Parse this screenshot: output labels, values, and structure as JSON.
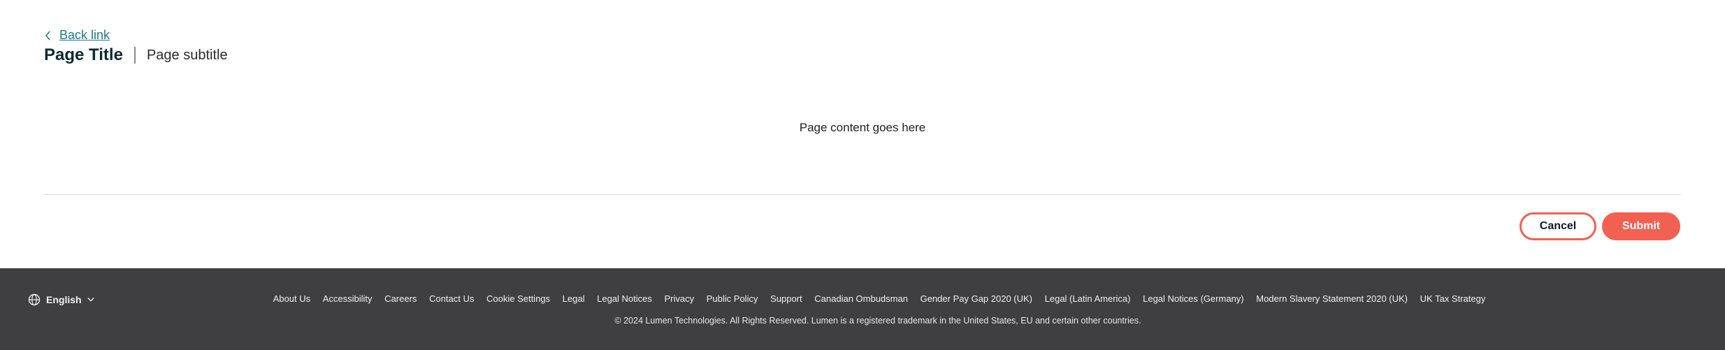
{
  "header": {
    "back_label": "Back link",
    "title": "Page Title",
    "subtitle": "Page subtitle"
  },
  "main": {
    "content_text": "Page content goes here"
  },
  "actions": {
    "cancel_label": "Cancel",
    "submit_label": "Submit"
  },
  "footer": {
    "language": "English",
    "links": [
      "About Us",
      "Accessibility",
      "Careers",
      "Contact Us",
      "Cookie Settings",
      "Legal",
      "Legal Notices",
      "Privacy",
      "Public Policy",
      "Support",
      "Canadian Ombudsman",
      "Gender Pay Gap 2020 (UK)",
      "Legal (Latin America)",
      "Legal Notices (Germany)",
      "Modern Slavery Statement 2020 (UK)",
      "UK Tax Strategy"
    ],
    "copyright": "© 2024 Lumen Technologies. All Rights Reserved. Lumen is a registered trademark in the United States, EU and certain other countries."
  },
  "colors": {
    "accent": "#f26052",
    "link": "#1f7a8c",
    "footer_bg": "#3f3e40"
  }
}
